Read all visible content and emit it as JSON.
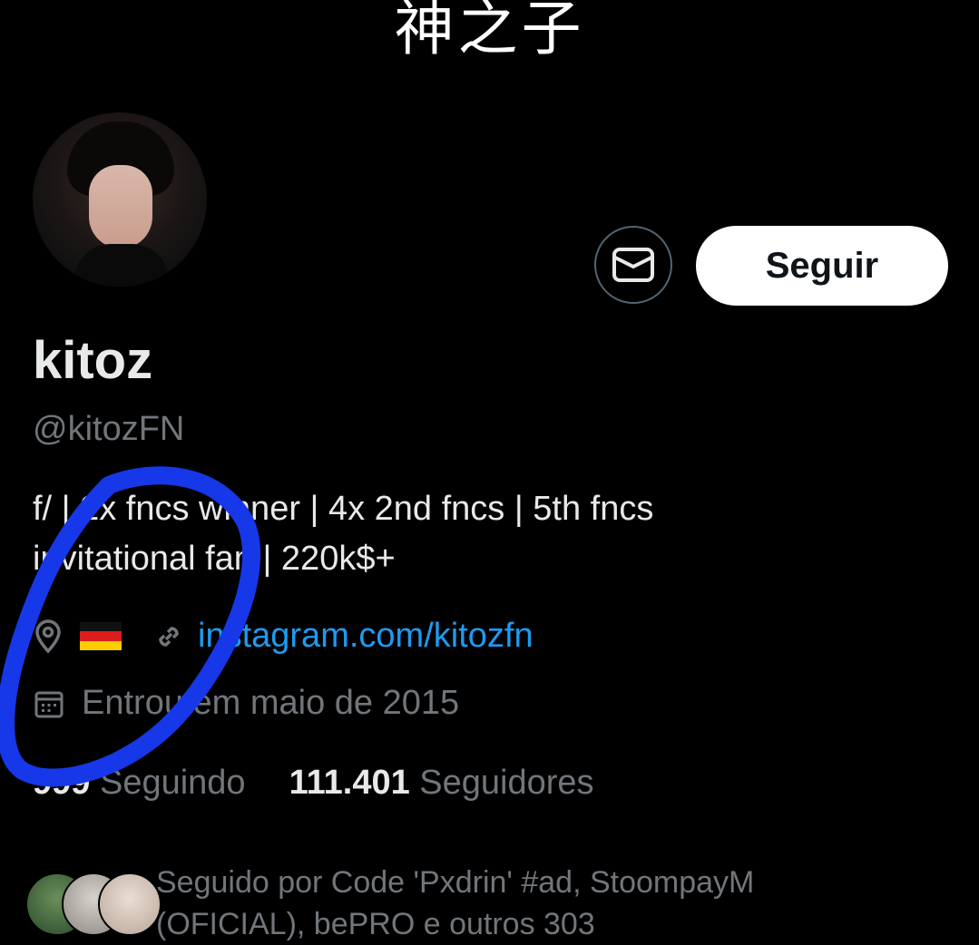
{
  "banner": {
    "title": "神之子"
  },
  "profile": {
    "name": "kitoz",
    "handle": "@kitozFN",
    "bio_line1": "f/ | 2x fncs winner | 4x 2nd fncs | 5th fncs",
    "bio_line2": "invitational fan | 220k$+",
    "location_flag": "🇩🇪",
    "website": "instagram.com/kitozfn",
    "joined": "Entrou em maio de 2015"
  },
  "actions": {
    "follow_label": "Seguir",
    "message_icon": "mail-icon"
  },
  "stats": {
    "following_count": "999",
    "following_label": "Seguindo",
    "followers_count": "111.401",
    "followers_label": "Seguidores"
  },
  "followed_by": {
    "line1": "Seguido por Code 'Pxdrin' #ad, StoompayM",
    "line2": "(OFICIAL), bePRO e outros 303"
  },
  "colors": {
    "background": "#000000",
    "text": "#e7e9ea",
    "muted": "#71767b",
    "link": "#1d9bf0",
    "annotation_ink": "#1638e8"
  }
}
